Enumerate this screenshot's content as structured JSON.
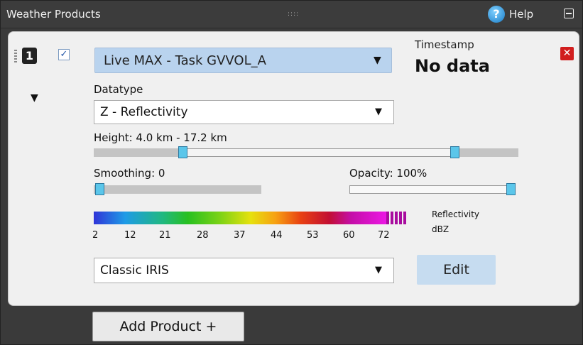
{
  "window": {
    "title": "Weather Products",
    "grip": "::::",
    "help_label": "Help",
    "help_glyph": "?"
  },
  "product": {
    "index": "1",
    "enabled": true,
    "check_glyph": "✓",
    "expand_glyph": "▼",
    "task": "Live MAX - Task GVVOL_A",
    "timestamp_label": "Timestamp",
    "timestamp_value": "No data",
    "close_glyph": "✕",
    "datatype_label": "Datatype",
    "datatype": "Z - Reflectivity",
    "height_label": "Height: 4.0 km - 17.2 km",
    "height_range_fraction": [
      0.21,
      0.85
    ],
    "smoothing_label": "Smoothing: 0",
    "smoothing_fraction": 0,
    "opacity_label": "Opacity: 100%",
    "opacity_fraction": 1.0,
    "colorbar_ticks": [
      "2",
      "12",
      "21",
      "28",
      "37",
      "44",
      "53",
      "60",
      "72"
    ],
    "legend_title": "Reflectivity",
    "legend_unit": "dBZ",
    "palette": "Classic IRIS",
    "edit_label": "Edit"
  },
  "footer": {
    "add_label": "Add Product +"
  },
  "colors": {
    "accent": "#b9d3ee",
    "thumb": "#5bc6ea",
    "close": "#d11e1e",
    "header": "#3c3c3c"
  },
  "icons": [
    "help-icon",
    "minimize-icon",
    "close-icon",
    "dropdown-arrow-icon",
    "expand-arrow-icon",
    "drag-handle-icon"
  ]
}
